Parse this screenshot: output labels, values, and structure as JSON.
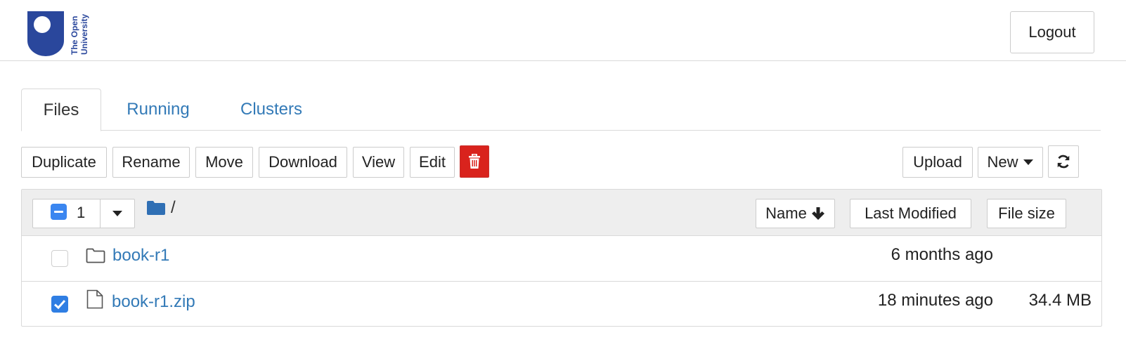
{
  "header": {
    "logo_text_line1": "The Open",
    "logo_text_line2": "University",
    "logout_label": "Logout"
  },
  "tabs": [
    {
      "label": "Files",
      "active": true
    },
    {
      "label": "Running",
      "active": false
    },
    {
      "label": "Clusters",
      "active": false
    }
  ],
  "toolbar": {
    "actions": [
      "Duplicate",
      "Rename",
      "Move",
      "Download",
      "View",
      "Edit"
    ],
    "delete_icon": "trash-icon",
    "upload_label": "Upload",
    "new_label": "New",
    "refresh_icon": "refresh-icon"
  },
  "list_header": {
    "selected_count": "1",
    "path": "/",
    "sort_name_label": "Name",
    "sort_modified_label": "Last Modified",
    "sort_size_label": "File size"
  },
  "files": [
    {
      "name": "book-r1",
      "type": "folder",
      "modified": "6 months ago",
      "size": "",
      "checked": false
    },
    {
      "name": "book-r1.zip",
      "type": "file",
      "modified": "18 minutes ago",
      "size": "34.4 MB",
      "checked": true
    }
  ],
  "colors": {
    "link": "#337ab7",
    "danger": "#d9231d",
    "checkbox_checked": "#2f7ee3",
    "logo": "#2a479c"
  }
}
